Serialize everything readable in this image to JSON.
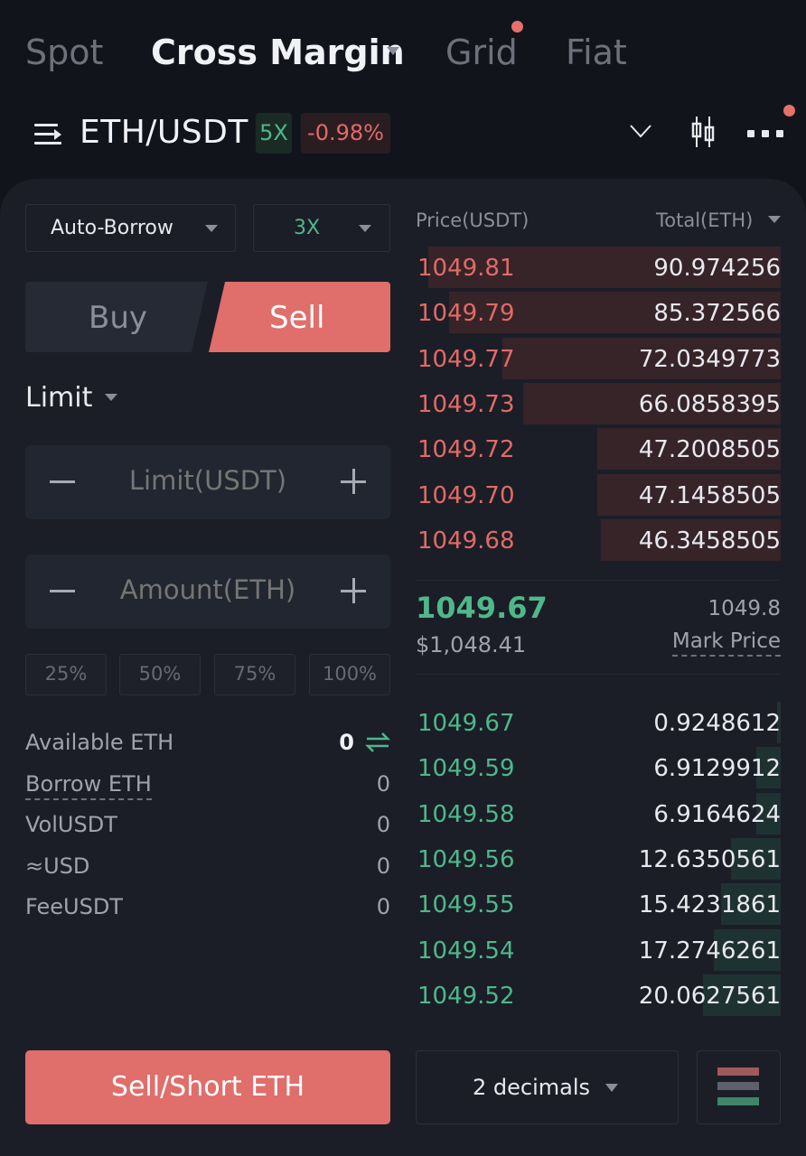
{
  "colors": {
    "sell": "#e06e6b",
    "buy": "#4fb88a",
    "background": "#1b1e27"
  },
  "top_tabs": [
    {
      "label": "Spot",
      "active": false
    },
    {
      "label": "Cross Margin",
      "active": true,
      "has_dropdown": true
    },
    {
      "label": "Grid",
      "active": false,
      "notification_dot": true
    },
    {
      "label": "Fiat",
      "active": false
    }
  ],
  "pair": {
    "menu_icon": "menu-icon",
    "name": "ETH/USDT",
    "leverage_badge": "5X",
    "change_badge": "-0.98%",
    "icons": [
      "chevron-down-icon",
      "candlestick-chart-icon",
      "more-icon"
    ]
  },
  "order_form": {
    "margin_mode": "Auto-Borrow",
    "leverage": "3X",
    "side_buy": "Buy",
    "side_sell": "Sell",
    "active_side": "Sell",
    "order_type": "Limit",
    "price_placeholder": "Limit(USDT)",
    "amount_placeholder": "Amount(ETH)",
    "percent_buttons": [
      "25%",
      "50%",
      "75%",
      "100%"
    ],
    "info": [
      {
        "label": "Available ETH",
        "value": "0"
      },
      {
        "label": "Borrow ETH",
        "value": "0"
      },
      {
        "label": "VolUSDT",
        "value": "0"
      },
      {
        "label": "≈USD",
        "value": "0"
      },
      {
        "label": "FeeUSDT",
        "value": "0"
      }
    ],
    "submit_label": "Sell/Short ETH"
  },
  "order_book": {
    "price_header": "Price(USDT)",
    "total_header": "Total(ETH)",
    "asks": [
      {
        "price": "1049.81",
        "total": "90.974256",
        "depth_pct": 100
      },
      {
        "price": "1049.79",
        "total": "85.372566",
        "depth_pct": 94
      },
      {
        "price": "1049.77",
        "total": "72.0349773",
        "depth_pct": 79
      },
      {
        "price": "1049.73",
        "total": "66.0858395",
        "depth_pct": 73
      },
      {
        "price": "1049.72",
        "total": "47.2008505",
        "depth_pct": 52
      },
      {
        "price": "1049.70",
        "total": "47.1458505",
        "depth_pct": 52
      },
      {
        "price": "1049.68",
        "total": "46.3458505",
        "depth_pct": 51
      }
    ],
    "last_price": "1049.67",
    "last_price_usd": "$1,048.41",
    "mark_price_value": "1049.8",
    "mark_price_label": "Mark Price",
    "bids": [
      {
        "price": "1049.67",
        "total": "0.9248612",
        "depth_pct": 1
      },
      {
        "price": "1049.59",
        "total": "6.9129912",
        "depth_pct": 7
      },
      {
        "price": "1049.58",
        "total": "6.9164624",
        "depth_pct": 7
      },
      {
        "price": "1049.56",
        "total": "12.6350561",
        "depth_pct": 14
      },
      {
        "price": "1049.55",
        "total": "15.4231861",
        "depth_pct": 17
      },
      {
        "price": "1049.54",
        "total": "17.2746261",
        "depth_pct": 19
      },
      {
        "price": "1049.52",
        "total": "20.0627561",
        "depth_pct": 22
      }
    ],
    "decimals_label": "2 decimals",
    "layout_icon": "orderbook-layout-icon"
  }
}
